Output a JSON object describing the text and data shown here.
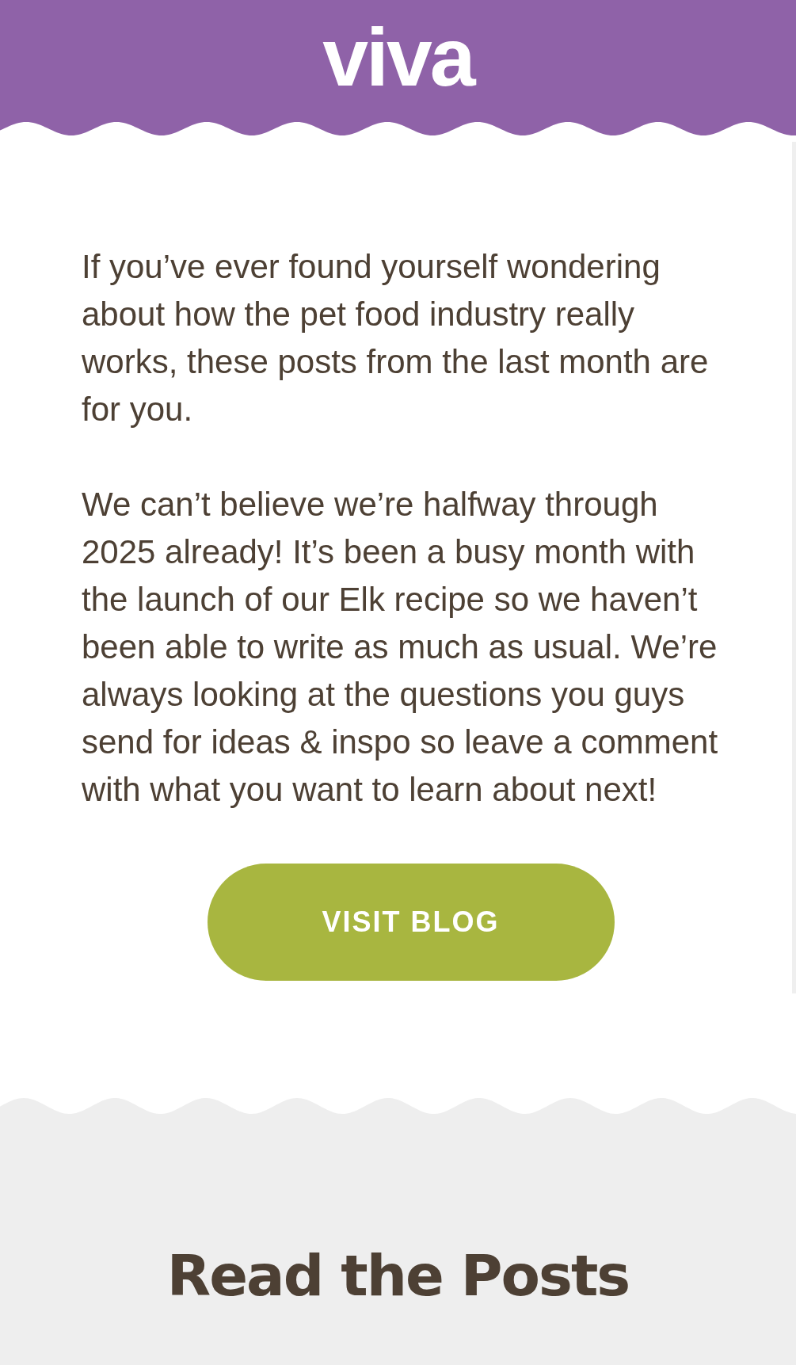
{
  "header": {
    "logo": "viva"
  },
  "intro": {
    "paragraphs": [
      "If you’ve ever found yourself wondering about how the pet food industry really works, these posts from the last month are for you.",
      "We can’t believe we’re halfway through 2025 already! It’s been a busy month with the launch of our Elk recipe so we haven’t been able to write as much as usual. We’re always looking at the questions you guys send for ideas & inspo so leave a comment with what you want to learn about next!"
    ],
    "button": "VISIT BLOG"
  },
  "posts": {
    "heading": "Read the Posts"
  }
}
